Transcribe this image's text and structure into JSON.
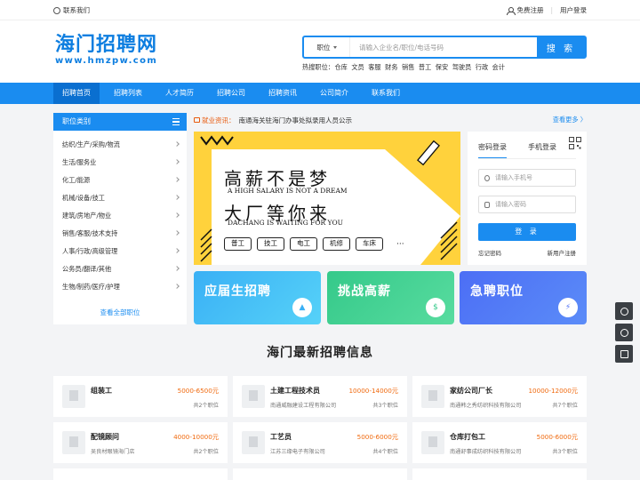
{
  "topbar": {
    "contact": "联系我们",
    "free_post": "免费注册",
    "login": "用户登录"
  },
  "logo": {
    "cn": "海门招聘网",
    "en": "www.hmzpw.com"
  },
  "search": {
    "select": "职位",
    "placeholder": "请输入企业名/职位/电话号码",
    "button": "搜 索"
  },
  "hot": {
    "label": "热搜职位：",
    "items": [
      "仓库",
      "文员",
      "客服",
      "财务",
      "销售",
      "普工",
      "保安",
      "驾驶员",
      "行政",
      "会计"
    ]
  },
  "nav": {
    "items": [
      "招聘首页",
      "招聘列表",
      "人才简历",
      "招聘公司",
      "招聘资讯",
      "公司简介",
      "联系我们"
    ]
  },
  "sidebar": {
    "title": "职位类别",
    "items": [
      "纺织/生产/采购/物流",
      "生活/服务业",
      "化工/能源",
      "机械/设备/技工",
      "建筑/房地产/物业",
      "销售/客服/技术支持",
      "人事/行政/高级管理",
      "公务员/翻译/其他",
      "生物/制药/医疗/护理"
    ],
    "all": "查看全部职位"
  },
  "notice": {
    "label": "就业资讯：",
    "text": "南通海关驻海门办事处拟录用人员公示",
    "more": "查看更多 〉"
  },
  "banner": {
    "title1": "高薪不是梦",
    "sub1": "A HIGH SALARY IS NOT A DREAM",
    "title2": "大厂等你来",
    "sub2": "DACHANG IS WAITING FOR YOU",
    "tags": [
      "普工",
      "技工",
      "电工",
      "机修",
      "车床"
    ],
    "dots": "···"
  },
  "login": {
    "tab1": "密码登录",
    "tab2": "手机登录",
    "phone_placeholder": "请输入手机号",
    "pwd_placeholder": "请输入密码",
    "submit": "登 录",
    "forgot": "忘记密码",
    "register": "新用户注册"
  },
  "promos": [
    "应届生招聘",
    "挑战高薪",
    "急聘职位"
  ],
  "section_title": "海门最新招聘信息",
  "jobs": [
    {
      "title": "组装工",
      "salary": "5000-6500元",
      "company": "",
      "count": "共2个职位"
    },
    {
      "title": "土建工程技术员",
      "salary": "10000-14000元",
      "company": "南通威融建设工程有限公司",
      "count": "共3个职位"
    },
    {
      "title": "家纺公司厂长",
      "salary": "10000-12000元",
      "company": "南通韩之秀纺织科技有限公司",
      "count": "共7个职位"
    },
    {
      "title": "配镜顾问",
      "salary": "4000-10000元",
      "company": "吴良材眼镜海门店",
      "count": "共2个职位"
    },
    {
      "title": "工艺员",
      "salary": "5000-6000元",
      "company": "江苏三缘电子有限公司",
      "count": "共4个职位"
    },
    {
      "title": "仓库打包工",
      "salary": "5000-6000元",
      "company": "南通舒事成纺织科技有限公司",
      "count": "共3个职位"
    }
  ],
  "colors": {
    "brand": "#1a8cf0",
    "salary": "#f06a0f",
    "banner_yellow": "#ffd23c"
  }
}
